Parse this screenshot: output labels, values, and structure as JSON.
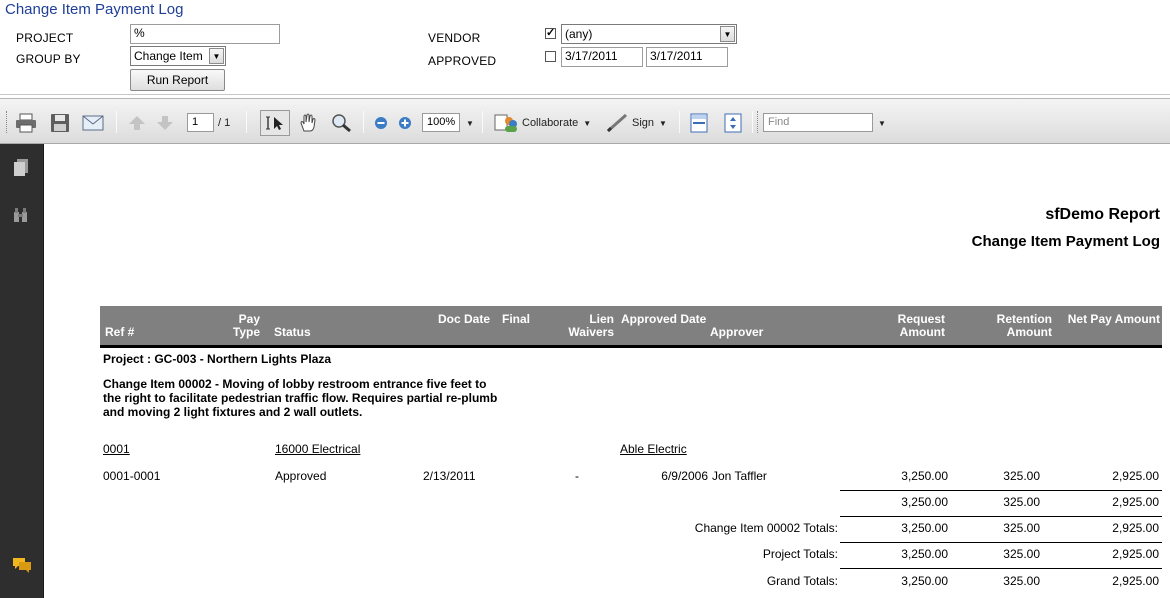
{
  "page": {
    "title": "Change Item Payment Log"
  },
  "filters": {
    "project_label": "Project",
    "project_value": "%",
    "group_by_label": "Group By",
    "group_by_value": "Change Item",
    "run_report_label": "Run Report",
    "vendor_label": "Vendor",
    "vendor_checked": true,
    "vendor_value": "(any)",
    "approved_label": "Approved",
    "approved_checked": false,
    "approved_from": "3/17/2011",
    "approved_to": "3/17/2011"
  },
  "toolbar": {
    "page_current": "1",
    "page_total": "/ 1",
    "zoom": "100%",
    "collaborate_label": "Collaborate",
    "sign_label": "Sign",
    "find_placeholder": "Find",
    "icons": [
      "print-icon",
      "save-icon",
      "email-icon",
      "prev-page-icon",
      "next-page-icon",
      "select-tool-icon",
      "hand-tool-icon",
      "marquee-zoom-icon",
      "zoom-out-icon",
      "zoom-in-icon",
      "collaborate-icon",
      "sign-icon",
      "fit-width-icon",
      "fit-page-icon"
    ]
  },
  "sidebar": {
    "icons": [
      "pages-icon",
      "attachments-icon",
      "comments-icon"
    ]
  },
  "report": {
    "company": "sfDemo Report",
    "title": "Change Item Payment Log",
    "columns": {
      "ref": "Ref #",
      "pay_type": "Pay\nType",
      "status": "Status",
      "doc_date": "Doc Date",
      "final": "Final",
      "lien_waivers": "Lien\nWaivers",
      "approved_date": "Approved Date",
      "approver": "Approver",
      "request_amount": "Request\nAmount",
      "retention_amount": "Retention\nAmount",
      "net_pay_amount": "Net Pay Amount"
    },
    "project_heading": "Project : GC-003 - Northern Lights Plaza",
    "change_item_heading": "Change Item 00002 - Moving of lobby restroom entrance five feet to the right to facilitate pedestrian traffic flow. Requires partial re-plumb and moving 2 light fixtures and 2 wall outlets.",
    "group": {
      "code": "0001",
      "cost_code": "16000 Electrical",
      "vendor": "Able Electric"
    },
    "row": {
      "ref": "0001-0001",
      "status": "Approved",
      "doc_date": "2/13/2011",
      "lien_waivers": "-",
      "approved_date": "6/9/2006",
      "approver": "Jon Taffler",
      "request_amount": "3,250.00",
      "retention_amount": "325.00",
      "net_pay_amount": "2,925.00"
    },
    "subtotal": {
      "request_amount": "3,250.00",
      "retention_amount": "325.00",
      "net_pay_amount": "2,925.00"
    },
    "change_item_totals": {
      "label": "Change Item 00002 Totals:",
      "request_amount": "3,250.00",
      "retention_amount": "325.00",
      "net_pay_amount": "2,925.00"
    },
    "project_totals": {
      "label": "Project Totals:",
      "request_amount": "3,250.00",
      "retention_amount": "325.00",
      "net_pay_amount": "2,925.00"
    },
    "grand_totals": {
      "label": "Grand Totals:",
      "request_amount": "3,250.00",
      "retention_amount": "325.00",
      "net_pay_amount": "2,925.00"
    }
  }
}
